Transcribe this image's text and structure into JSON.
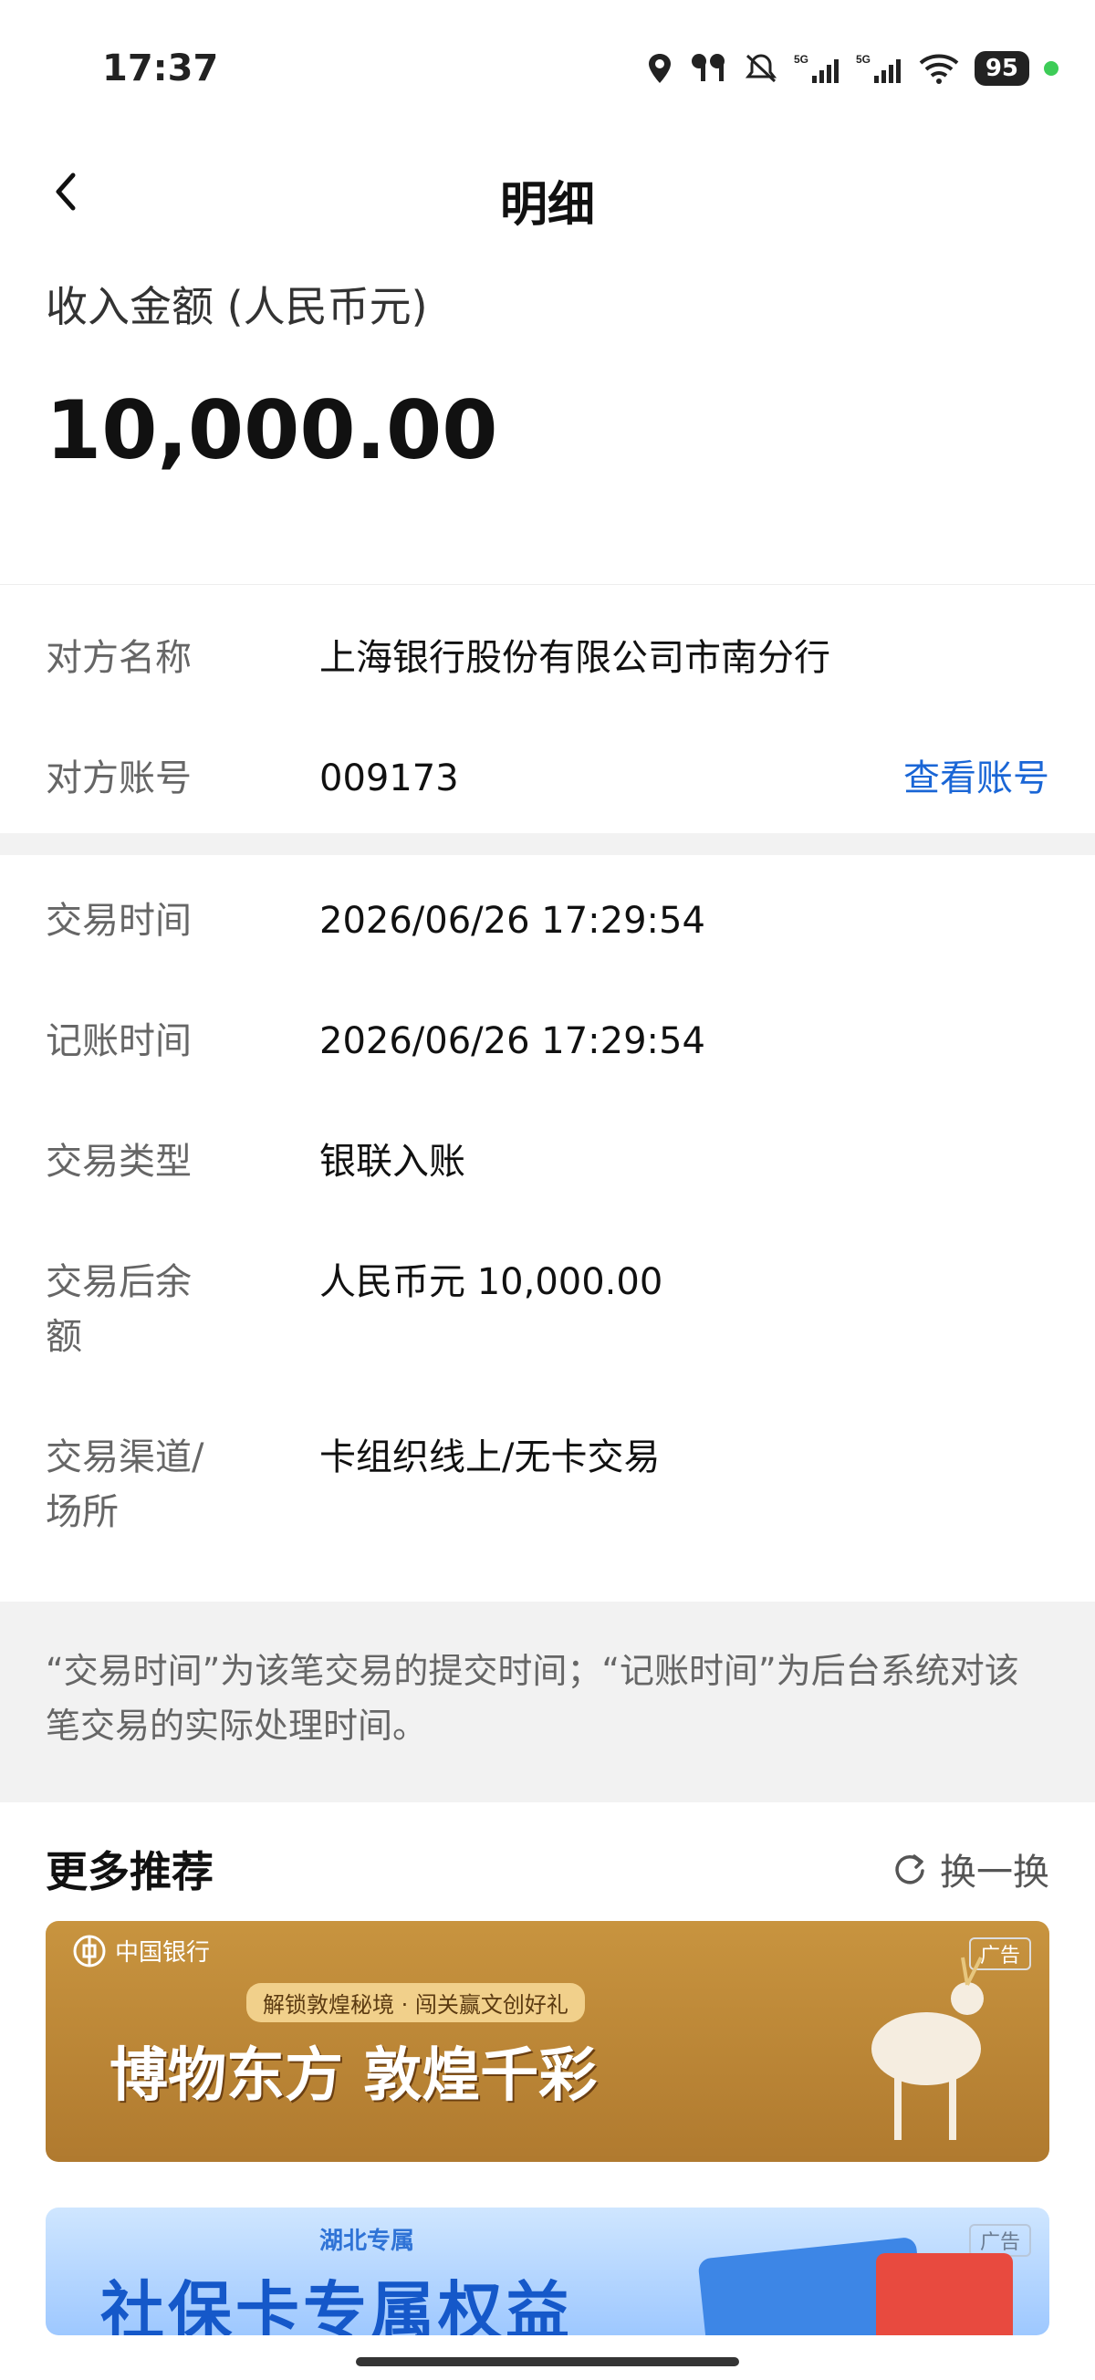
{
  "status_bar": {
    "time": "17:37",
    "battery": "95",
    "network": [
      "5G",
      "5G"
    ]
  },
  "nav": {
    "title": "明细"
  },
  "amount": {
    "label": "收入金额 (人民币元)",
    "value": "10,000.00"
  },
  "counterparty": [
    {
      "key": "对方名称",
      "value": "上海银行股份有限公司市南分行"
    },
    {
      "key": "对方账号",
      "value": "009173",
      "action": "查看账号"
    }
  ],
  "details": [
    {
      "key": "交易时间",
      "value": "2026/06/26 17:29:54"
    },
    {
      "key": "记账时间",
      "value": "2026/06/26 17:29:54"
    },
    {
      "key": "交易类型",
      "value": "银联入账"
    },
    {
      "key": "交易后余\n额",
      "value": "人民币元 10,000.00"
    },
    {
      "key": "交易渠道/\n场所",
      "value": "卡组织线上/无卡交易"
    }
  ],
  "note": "“交易时间”为该笔交易的提交时间；“记账时间”为后台系统对该笔交易的实际处理时间。",
  "more": {
    "title": "更多推荐",
    "refresh": "换一换"
  },
  "banners": [
    {
      "brand": "中国银行",
      "subtitle": "解锁敦煌秘境 · 闯关赢文创好礼",
      "headline": "博物东方 敦煌千彩",
      "tag": "广告"
    },
    {
      "subtitle": "湖北专属",
      "headline": "社保卡专属权益",
      "tag": "广告"
    }
  ],
  "colors": {
    "link": "#1a66d6",
    "separator": "#f2f2f2"
  }
}
